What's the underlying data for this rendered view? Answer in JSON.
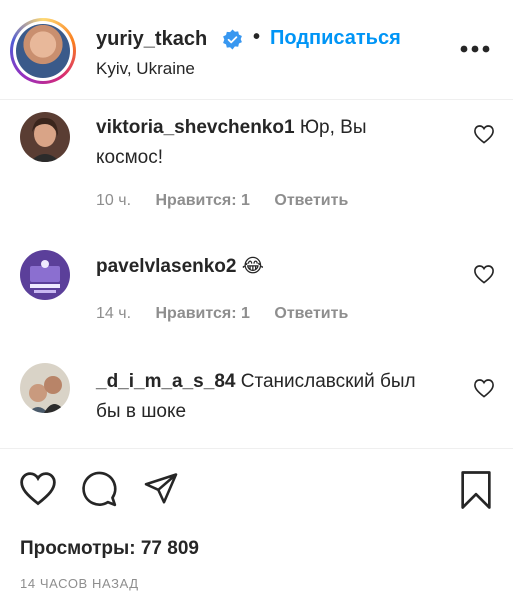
{
  "header": {
    "username": "yuriy_tkach",
    "separator": "•",
    "follow_label": "Подписаться",
    "location": "Kyiv, Ukraine"
  },
  "comments": [
    {
      "username": "viktoria_shevchenko1",
      "text": "Юр, Вы космос!",
      "time": "10 ч.",
      "likes": "Нравится: 1",
      "reply": "Ответить"
    },
    {
      "username": "pavelvlasenko2",
      "text": "😂",
      "time": "14 ч.",
      "likes": "Нравится: 1",
      "reply": "Ответить"
    },
    {
      "username": "_d_i_m_a_s_84",
      "text": "Станиславский был бы в шоке"
    }
  ],
  "footer": {
    "views": "Просмотры: 77 809",
    "posted_ago": "14 ЧАСОВ НАЗАД"
  },
  "colors": {
    "link_blue": "#0095f6",
    "text": "#262626",
    "muted": "#8e8e8e"
  },
  "icons": [
    "verified-badge-icon",
    "more-options-icon",
    "heart-icon",
    "comment-icon",
    "share-icon",
    "bookmark-icon"
  ]
}
